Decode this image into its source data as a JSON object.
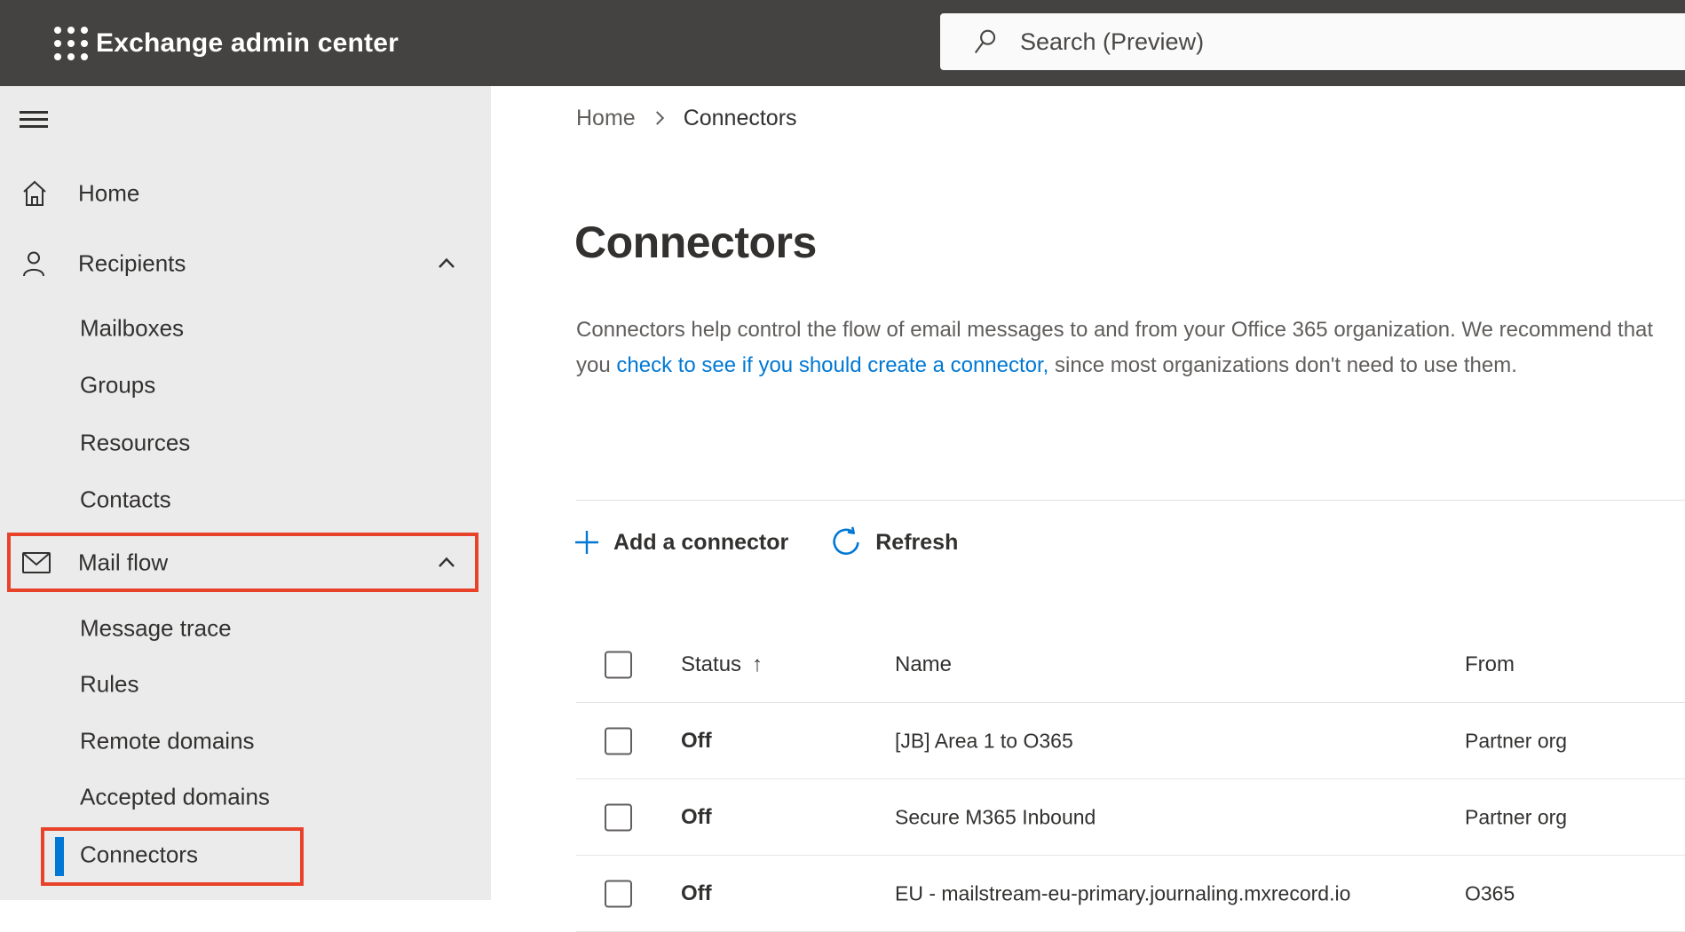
{
  "topbar": {
    "app_title": "Exchange admin center",
    "search_placeholder": "Search (Preview)"
  },
  "sidebar": {
    "items": [
      {
        "label": "Home"
      },
      {
        "label": "Recipients"
      },
      {
        "label": "Mailboxes"
      },
      {
        "label": "Groups"
      },
      {
        "label": "Resources"
      },
      {
        "label": "Contacts"
      },
      {
        "label": "Mail flow"
      },
      {
        "label": "Message trace"
      },
      {
        "label": "Rules"
      },
      {
        "label": "Remote domains"
      },
      {
        "label": "Accepted domains"
      },
      {
        "label": "Connectors"
      }
    ],
    "selected_item": "Connectors"
  },
  "annotations": {
    "highlighted_items": [
      "Mail flow",
      "Connectors"
    ],
    "highlight_color": "#e8432a"
  },
  "breadcrumb": {
    "home": "Home",
    "current": "Connectors"
  },
  "page": {
    "title": "Connectors"
  },
  "description": {
    "text_before_link": "Connectors help control the flow of email messages to and from your Office 365 organization. We recommend that you ",
    "link_text": "check to see if you should create a connector,",
    "text_after_link": " since most organizations don't need to use them."
  },
  "toolbar": {
    "add_label": "Add a connector",
    "refresh_label": "Refresh"
  },
  "table": {
    "columns": [
      "Status",
      "Name",
      "From"
    ],
    "sort": {
      "column": "Status",
      "direction": "ascending",
      "icon": "↑"
    },
    "rows": [
      {
        "status": "Off",
        "name": "[JB] Area 1 to O365",
        "from": "Partner org"
      },
      {
        "status": "Off",
        "name": "Secure M365 Inbound",
        "from": "Partner org"
      },
      {
        "status": "Off",
        "name": "EU - mailstream-eu-primary.journaling.mxrecord.io",
        "from": "O365"
      }
    ]
  },
  "colors": {
    "topbar_bg": "#454341",
    "sidebar_bg": "#ebebeb",
    "accent_blue": "#0078d4",
    "text_dark": "#323130",
    "text_gray": "#605e5c",
    "divider": "#e3e1df",
    "annotation_red": "#e8432a",
    "searchbox_bg": "#fafafa"
  }
}
